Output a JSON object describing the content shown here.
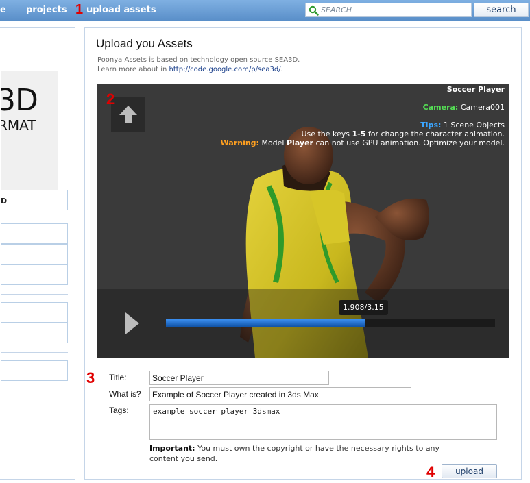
{
  "nav": {
    "partial_link": "e",
    "projects": "projects",
    "upload_assets": "upload assets",
    "search_placeholder": "SEARCH",
    "search_button": "search"
  },
  "markers": [
    "1",
    "2",
    "3",
    "4"
  ],
  "left": {
    "logo_big": "3D",
    "logo_small": "RMAT",
    "active_item": "D"
  },
  "main": {
    "title": "Upload you Assets",
    "intro_line1": "Poonya Assets is based on technology open source SEA3D.",
    "intro_line2_prefix": "Learn more about in ",
    "intro_link": "http://code.google.com/p/sea3d/",
    "intro_line2_suffix": "."
  },
  "viewer": {
    "model_name": "Soccer Player",
    "camera_label": "Camera:",
    "camera_value": "Camera001",
    "tips_label": "Tips:",
    "tips_value": "1 Scene Objects",
    "keys_prefix": "Use the keys ",
    "keys_value": "1-5",
    "keys_suffix": " for change the character animation.",
    "warning_label": "Warning:",
    "warning_prefix": "Model ",
    "warning_model": "Player",
    "warning_suffix": " can not use GPU animation. Optimize your model.",
    "time": "1.908/3.15",
    "progress": 0.606
  },
  "form": {
    "title_label": "Title:",
    "title_value": "Soccer Player",
    "whatis_label": "What is?",
    "whatis_value": "Example of Soccer Player created in 3ds Max",
    "tags_label": "Tags:",
    "tags_value": "example soccer player 3dsmax",
    "important_label": "Important:",
    "important_text": "You must own the copyright or have the necessary rights to any content you send.",
    "upload_button": "upload"
  },
  "colors": {
    "nav_bar": "#6a9bd0",
    "marker_red": "#e00000",
    "camera_green": "#55e055",
    "tips_blue": "#3aa5ff",
    "warning_orange": "#ffa020",
    "progress_blue": "#1469c7"
  }
}
